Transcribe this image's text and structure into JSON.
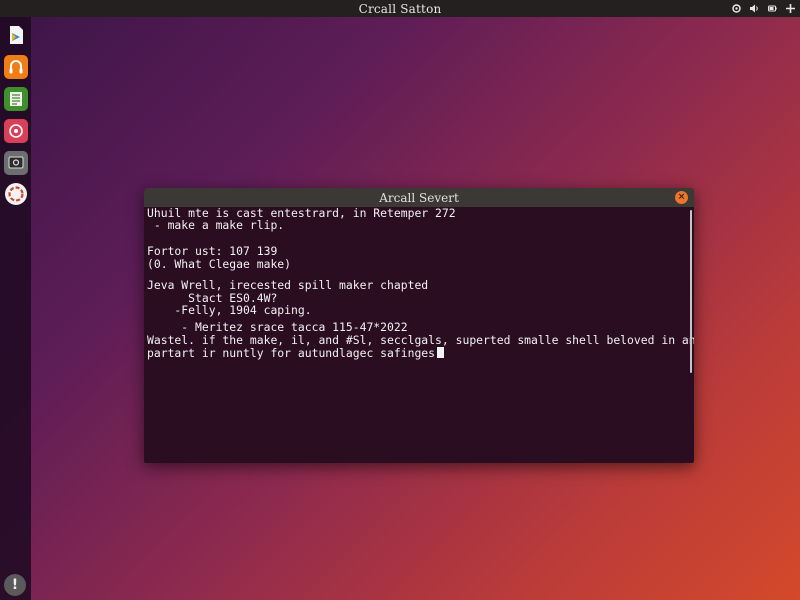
{
  "topbar": {
    "title": "Crcall Satton",
    "icons": [
      "settings-icon",
      "sound-icon",
      "battery-icon",
      "add-icon"
    ]
  },
  "launcher": {
    "items": [
      "files-icon",
      "music-icon",
      "office-icon",
      "app-store-icon",
      "screenshot-icon",
      "help-icon"
    ],
    "bottom": "info-icon"
  },
  "terminal": {
    "title": "Arcall Severt",
    "lines": [
      "Uhuil mte is cast entestrard, in Retemper 272",
      " - make a make rlip.",
      "",
      "Fortor ust: 107 139",
      "(0. What Clegae make)",
      "",
      "Jeva Wrell, irecested spill maker chapted",
      "      Stact ES0.4W?",
      "    -Felly, 1904 caping.",
      "",
      "     - Meritez srace tacca 115-47*2022",
      "Wastel. if the make, il, and #Sl, secclgals, superted smalle shell beloved in and",
      "partart ir nuntly for autundlagec safinges"
    ]
  },
  "colors": {
    "terminal_bg": "#2b0d22",
    "topbar_bg": "#24201f",
    "accent_orange": "#e9762b"
  }
}
